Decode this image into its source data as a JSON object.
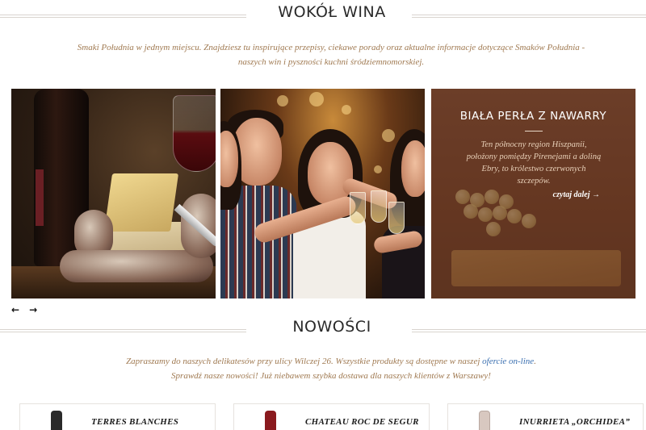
{
  "wine_section": {
    "title": "WOKÓŁ WINA",
    "intro": "Smaki Południa w jednym miejscu. Znajdziesz tu inspirujące przepisy, ciekawe porady oraz aktualne informacje dotyczące Smaków Południa - naszych win i pyszności kuchni śródziemnomorskiej."
  },
  "slider": {
    "featured": {
      "title": "BIAŁA PERŁA Z NAWARRY",
      "text": "Ten północny region Hiszpanii, położony pomiędzy Pirenejami a doliną Ebry, to królestwo czerwonych szczepów.",
      "more_label": "czytaj dalej →"
    },
    "prev_icon": "←",
    "next_icon": "→"
  },
  "news_section": {
    "title": "NOWOŚCI",
    "intro_before_link": "Zapraszamy do naszych delikatesów przy ulicy Wilczej 26. Wszystkie produkty są dostępne w naszej ",
    "intro_link": "ofercie on-line",
    "intro_after_link": ".",
    "intro_line2": "Sprawdź nasze nowości! Już niebawem szybka dostawa dla naszych klientów z Warszawy!"
  },
  "products": [
    {
      "name": "TERRES BLANCHES",
      "bottle_color": "#2a2a2a"
    },
    {
      "name": "CHATEAU ROC DE SEGUR",
      "bottle_color": "#8a1a1e"
    },
    {
      "name": "INURRIETA „ORCHIDEA”",
      "bottle_color": "#d8c8c0"
    }
  ],
  "colors": {
    "accent_text": "#a07a52",
    "link": "#3a6fb0",
    "heading": "#2a2a2a"
  }
}
